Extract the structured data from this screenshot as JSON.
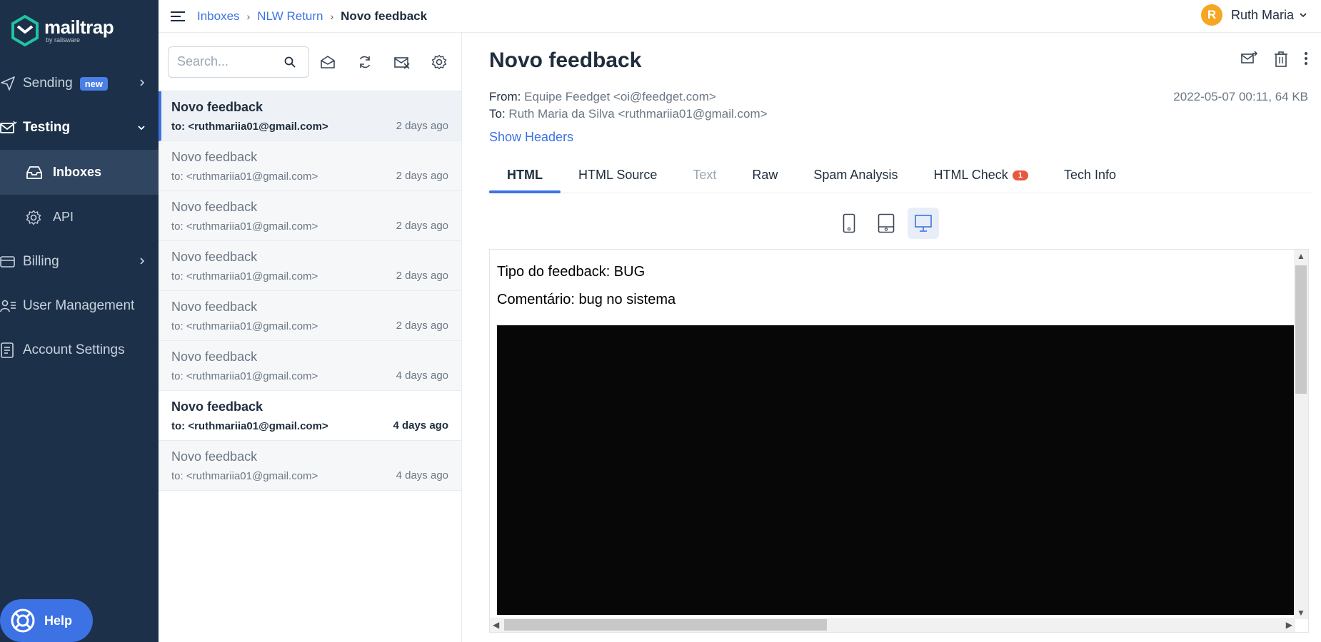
{
  "brand": {
    "name": "mailtrap",
    "sub": "by railsware"
  },
  "sidebar": {
    "sending": {
      "label": "Sending",
      "badge": "new"
    },
    "testing": {
      "label": "Testing"
    },
    "inboxes": {
      "label": "Inboxes"
    },
    "api": {
      "label": "API"
    },
    "billing": {
      "label": "Billing"
    },
    "users": {
      "label": "User Management"
    },
    "account": {
      "label": "Account Settings"
    },
    "help": {
      "label": "Help"
    }
  },
  "breadcrumb": {
    "inboxes": "Inboxes",
    "project": "NLW Return",
    "current": "Novo feedback"
  },
  "user": {
    "initial": "R",
    "name": "Ruth Maria"
  },
  "search": {
    "placeholder": "Search..."
  },
  "messages": [
    {
      "subject": "Novo feedback",
      "to": "to: <ruthmariia01@gmail.com>",
      "when": "2 days ago"
    },
    {
      "subject": "Novo feedback",
      "to": "to: <ruthmariia01@gmail.com>",
      "when": "2 days ago"
    },
    {
      "subject": "Novo feedback",
      "to": "to: <ruthmariia01@gmail.com>",
      "when": "2 days ago"
    },
    {
      "subject": "Novo feedback",
      "to": "to: <ruthmariia01@gmail.com>",
      "when": "2 days ago"
    },
    {
      "subject": "Novo feedback",
      "to": "to: <ruthmariia01@gmail.com>",
      "when": "2 days ago"
    },
    {
      "subject": "Novo feedback",
      "to": "to: <ruthmariia01@gmail.com>",
      "when": "4 days ago"
    },
    {
      "subject": "Novo feedback",
      "to": "to: <ruthmariia01@gmail.com>",
      "when": "4 days ago"
    },
    {
      "subject": "Novo feedback",
      "to": "to: <ruthmariia01@gmail.com>",
      "when": "4 days ago"
    }
  ],
  "detail": {
    "title": "Novo feedback",
    "from_label": "From:",
    "from": "Equipe Feedget <oi@feedget.com>",
    "to_label": "To:",
    "to": "Ruth Maria da Silva <ruthmariia01@gmail.com>",
    "date": "2022-05-07 00:11, 64 KB",
    "show_headers": "Show Headers"
  },
  "tabs": [
    {
      "label": "HTML"
    },
    {
      "label": "HTML Source"
    },
    {
      "label": "Text"
    },
    {
      "label": "Raw"
    },
    {
      "label": "Spam Analysis"
    },
    {
      "label": "HTML Check",
      "badge": "1"
    },
    {
      "label": "Tech Info"
    }
  ],
  "preview": {
    "line1": "Tipo do feedback: BUG",
    "line2": "Comentário: bug no sistema"
  }
}
